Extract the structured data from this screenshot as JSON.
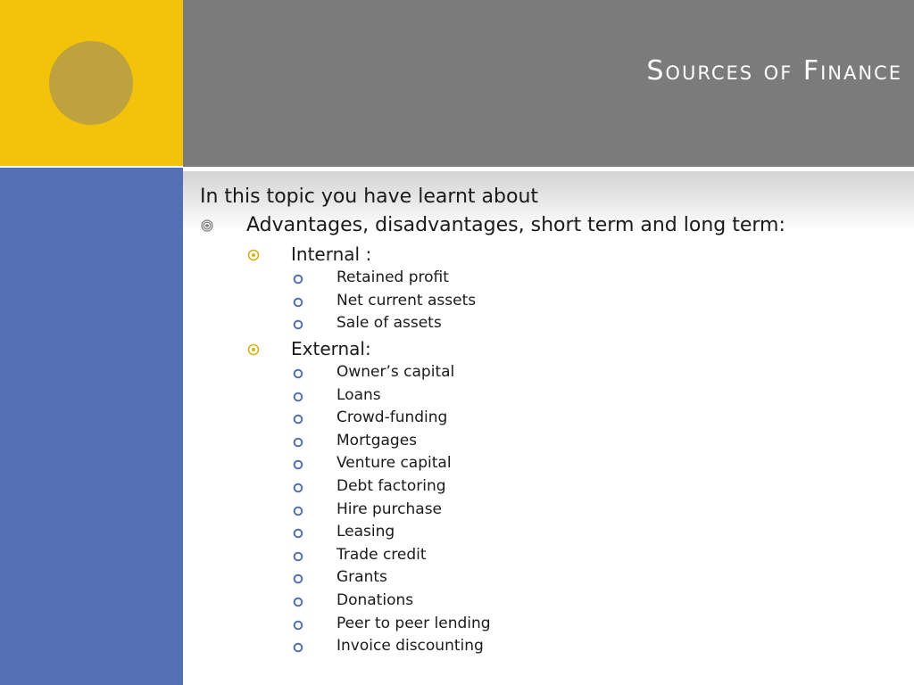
{
  "slide": {
    "title": "Sources of Finance",
    "intro": "In this topic you have learnt about",
    "main_point": "Advantages, disadvantages, short term and long term:",
    "internal": {
      "label": "Internal :",
      "items": [
        "Retained profit",
        "Net current assets",
        "Sale of assets"
      ]
    },
    "external": {
      "label": "External:",
      "items": [
        "Owner’s capital",
        "Loans",
        "Crowd-funding",
        "Mortgages",
        "Venture capital",
        "Debt factoring",
        "Hire purchase",
        "Leasing",
        "Trade credit",
        "Grants",
        "Donations",
        "Peer to peer lending",
        "Invoice discounting"
      ]
    }
  },
  "colors": {
    "accent_yellow": "#f3c20a",
    "circle": "#bea23e",
    "header_gray": "#7b7b7b",
    "side_blue": "#5470b2",
    "bullet_level1": "#777777",
    "bullet_level2": "#d4b21a",
    "bullet_level3": "#5470b2"
  },
  "icons": {
    "level1_bullet": "concentric-circle-bullet-icon",
    "level2_bullet": "dotted-circle-bullet-icon",
    "level3_bullet": "ring-bullet-icon"
  }
}
